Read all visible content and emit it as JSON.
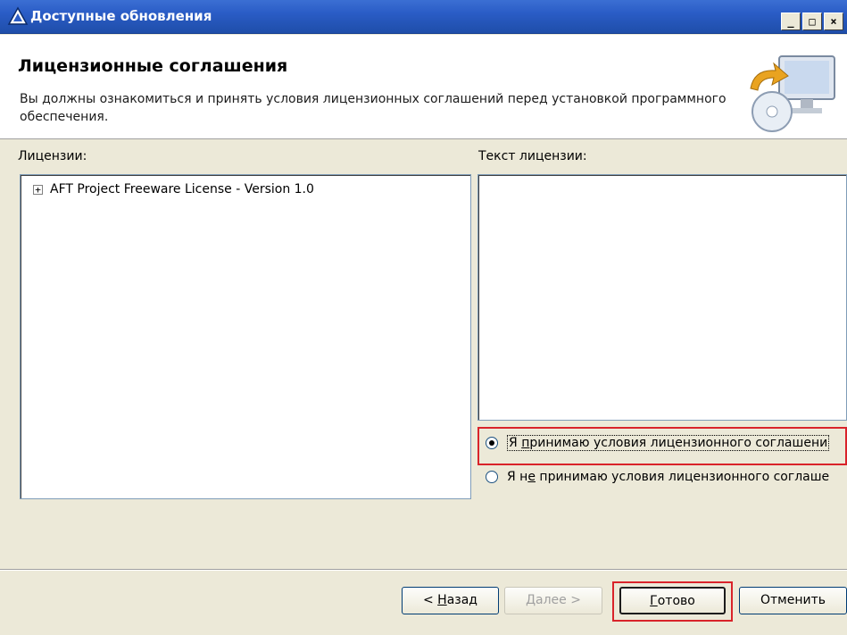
{
  "window": {
    "title": "Доступные обновления",
    "min_label": "_",
    "max_label": "□",
    "close_label": "×"
  },
  "header": {
    "title": "Лицензионные соглашения",
    "description": "Вы должны ознакомиться и принять условия лицензионных соглашений перед установкой программного обеспечения."
  },
  "licenses": {
    "label": "Лицензии:",
    "items": [
      {
        "expander": "+",
        "label": "AFT Project Freeware License - Version 1.0"
      }
    ]
  },
  "license_text": {
    "label": "Текст лицензии:",
    "content": ""
  },
  "options": {
    "accept": {
      "prefix": "Я ",
      "mnemonic": "п",
      "rest": "ринимаю условия лицензионного соглашени",
      "checked": true
    },
    "decline": {
      "prefix": "Я н",
      "mnemonic": "е",
      "rest": " принимаю условия лицензионного соглаше",
      "checked": false
    }
  },
  "buttons": {
    "back": {
      "prefix": "< ",
      "mnemonic": "Н",
      "rest": "азад"
    },
    "next": {
      "mnemonic": "Д",
      "rest": "алее >",
      "enabled": false
    },
    "finish": {
      "mnemonic": "Г",
      "rest": "отово"
    },
    "cancel": {
      "label": "Отменить"
    }
  },
  "colors": {
    "highlight": "#d9232a",
    "titlebar": "#2a5cc6"
  }
}
